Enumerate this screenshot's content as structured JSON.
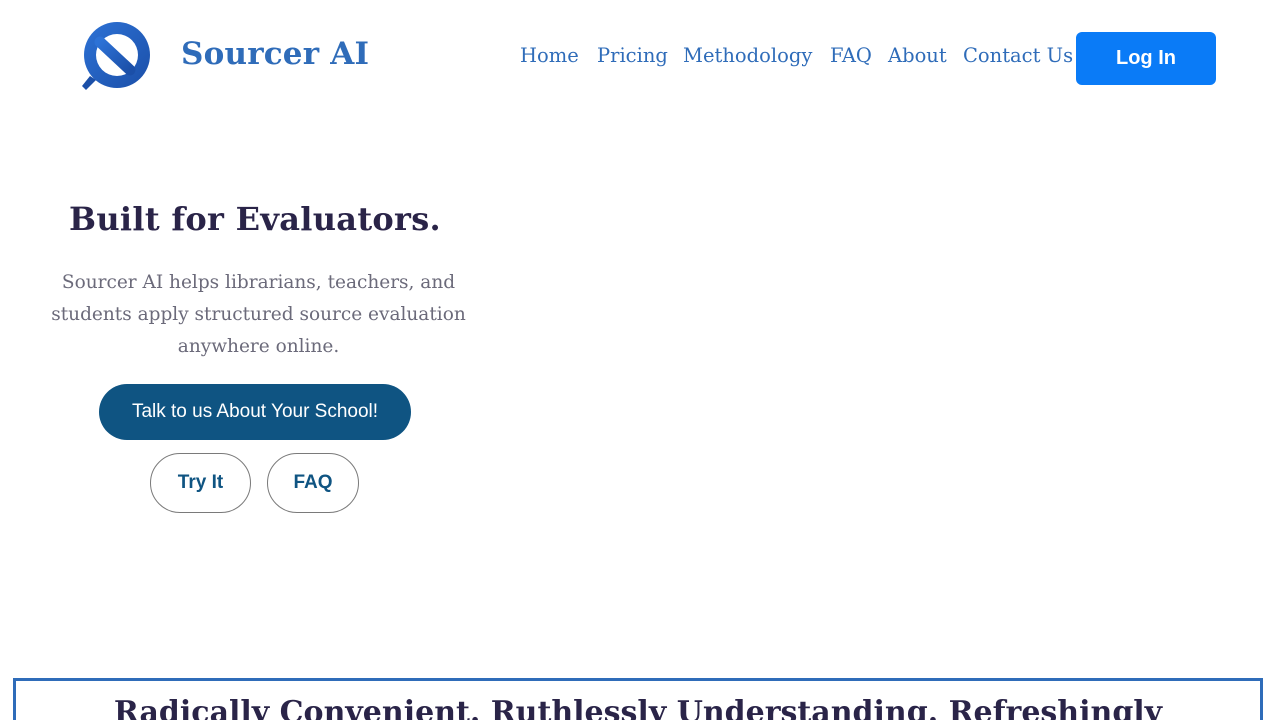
{
  "header": {
    "brand": "Sourcer AI",
    "logo_icon": "magnifier-slash-logo",
    "brand_color": "#2f6cb9",
    "nav": {
      "home": "Home",
      "pricing": "Pricing",
      "methodology": "Methodology",
      "faq": "FAQ",
      "about": "About",
      "contact": "Contact Us"
    },
    "login": "Log In",
    "login_color": "#0a7bf7"
  },
  "hero": {
    "title": "Built for Evaluators.",
    "subtitle": "Sourcer AI helps librarians, teachers, and students apply structured source evaluation anywhere online.",
    "cta": "Talk to us About Your School!",
    "cta_color": "#0f5482",
    "try_it": "Try It",
    "faq": "FAQ"
  },
  "banner": {
    "text": "Radically Convenient. Ruthlessly Understanding. Refreshingly"
  }
}
